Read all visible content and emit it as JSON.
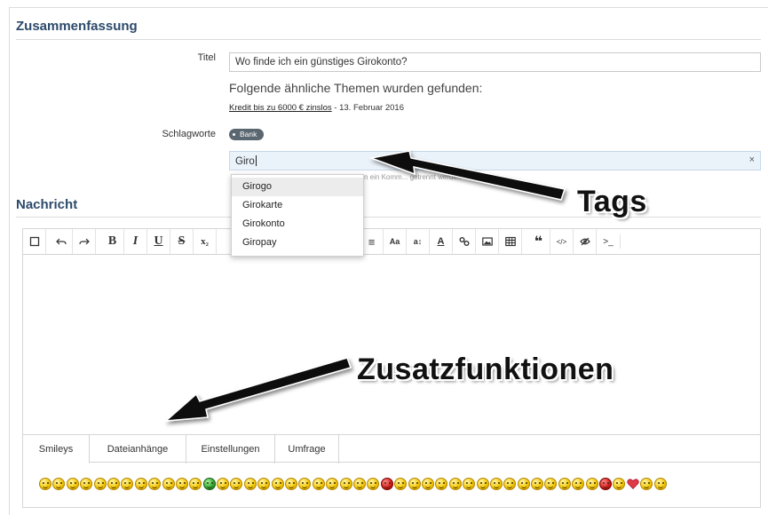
{
  "summary": {
    "heading": "Zusammenfassung",
    "title_label": "Titel",
    "title_value": "Wo finde ich ein günstiges Girokonto?",
    "similar_heading": "Folgende ähnliche Themen wurden gefunden:",
    "similar_link": "Kredit bis zu 6000 € zinslos",
    "similar_date": "- 13. Februar 2016",
    "tags_label": "Schlagworte",
    "existing_tag": "Bank",
    "tag_input_value": "Giro",
    "tag_clear": "×",
    "tag_hint": "n ein Komm... getrennt werden"
  },
  "tag_suggestions": [
    "Girogo",
    "Girokarte",
    "Girokonto",
    "Giropay"
  ],
  "message": {
    "heading": "Nachricht"
  },
  "toolbar": {
    "buttons": [
      {
        "name": "source-toggle-icon",
        "glyph": "☐"
      },
      {
        "name": "undo-icon",
        "glyph": "↶"
      },
      {
        "name": "redo-icon",
        "glyph": "↷"
      },
      {
        "name": "bold-icon",
        "glyph": "B"
      },
      {
        "name": "italic-icon",
        "glyph": "I"
      },
      {
        "name": "underline-icon",
        "glyph": "U"
      },
      {
        "name": "strikethrough-icon",
        "glyph": "S"
      },
      {
        "name": "subscript-icon",
        "glyph": "x₂"
      },
      {
        "name": "align-icon",
        "glyph": "≡"
      },
      {
        "name": "font-size-icon",
        "glyph": "Aa"
      },
      {
        "name": "line-height-icon",
        "glyph": "a↕"
      },
      {
        "name": "text-color-icon",
        "glyph": "A"
      },
      {
        "name": "link-icon",
        "glyph": "🔗"
      },
      {
        "name": "image-icon",
        "glyph": "▣"
      },
      {
        "name": "table-icon",
        "glyph": "▦"
      },
      {
        "name": "quote-icon",
        "glyph": "❝"
      },
      {
        "name": "code-icon",
        "glyph": "</>"
      },
      {
        "name": "spoiler-icon",
        "glyph": "👁"
      },
      {
        "name": "terminal-icon",
        "glyph": ">_"
      }
    ]
  },
  "tabs": [
    "Smileys",
    "Dateianhänge",
    "Einstellungen",
    "Umfrage"
  ],
  "annotations": {
    "tags": "Tags",
    "extras": "Zusatzfunktionen"
  },
  "colors": {
    "section_heading": "#2c4a6b",
    "tag_input_bg": "#eaf2fa",
    "tag_pill": "#5a6670"
  }
}
